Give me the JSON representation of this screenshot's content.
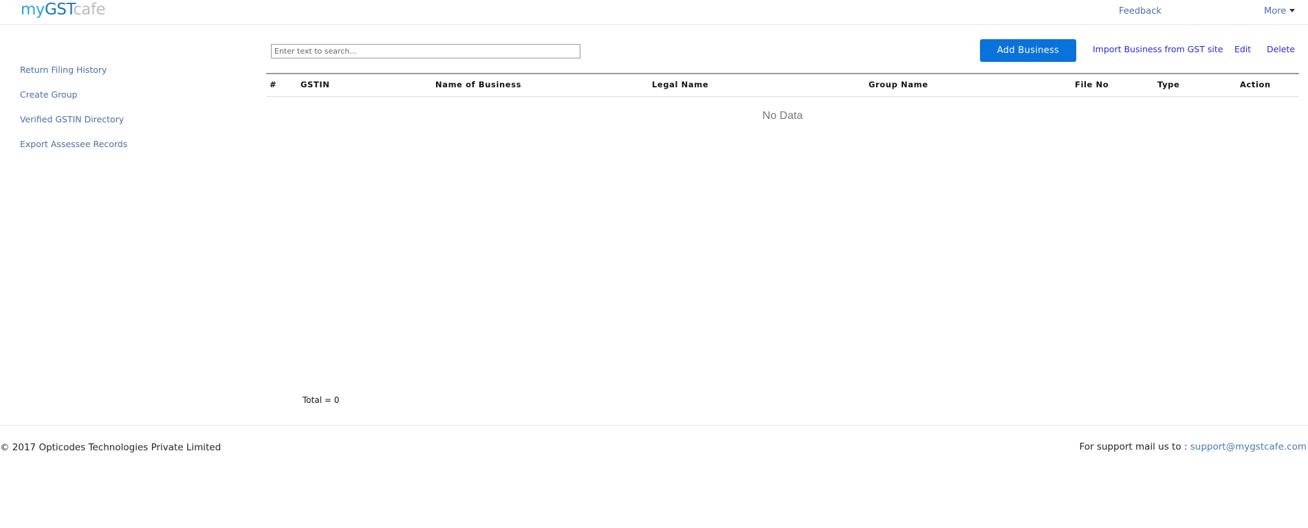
{
  "header": {
    "logo": {
      "part1": "my",
      "part2": "GST",
      "part3": "cafe"
    },
    "nav": {
      "feedback": "Feedback",
      "more": "More"
    },
    "colors": {
      "logo_my": "#29a9e0",
      "logo_gst": "#1b75bb",
      "logo_cafe": "#bcbcbc",
      "link": "#4a6fa5"
    }
  },
  "sidebar": {
    "items": [
      {
        "label": "Return Filing History"
      },
      {
        "label": "Create Group"
      },
      {
        "label": "Verified GSTIN Directory"
      },
      {
        "label": "Export Assessee Records"
      }
    ]
  },
  "toolbar": {
    "search": {
      "value": "",
      "placeholder": "Enter text to search..."
    },
    "add_business_label": "Add Business",
    "import_label": "Import Business from GST site",
    "edit_label": "Edit",
    "delete_label": "Delete",
    "colors": {
      "primary_button": "#0a72dc",
      "action_link": "#2a2adb"
    }
  },
  "table": {
    "columns": [
      "#",
      "GSTIN",
      "Name of Business",
      "Legal Name",
      "Group Name",
      "File No",
      "Type",
      "Action"
    ],
    "rows": [],
    "empty_message": "No Data",
    "total_label": "Total = 0"
  },
  "footer": {
    "copyright": "© 2017 Opticodes Technologies Private Limited",
    "support_text": "For support mail us to : ",
    "support_email": "support@mygstcafe.com"
  }
}
